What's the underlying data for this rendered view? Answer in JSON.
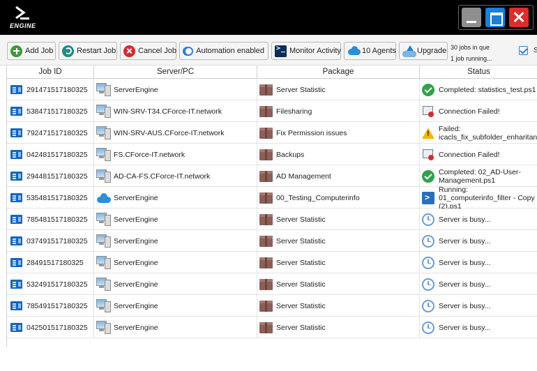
{
  "app": {
    "logo_text": "ENGINE"
  },
  "toolbar": {
    "add_job": "Add Job",
    "restart_job": "Restart Job",
    "cancel_job": "Cancel Job",
    "automation": "Automation enabled",
    "monitor_activity": "Monitor Activity",
    "agents": "10 Agents",
    "upgrade": "Upgrade",
    "queue_line1": "30 jobs in que",
    "queue_line2": "1 job running...",
    "checkbox_label": "S"
  },
  "colors": {
    "titlebar": "#000000",
    "accent": "#2f7dd6",
    "close": "#e02b2b",
    "maximize": "#1c7fd8",
    "minimize": "#8f8f8f"
  },
  "table": {
    "headers": {
      "job_id": "Job ID",
      "server": "Server/PC",
      "package": "Package",
      "status": "Status"
    },
    "rows": [
      {
        "id": "291471517180325",
        "server": "ServerEngine",
        "server_icon": "server-pc-icon",
        "package": "Server Statistic",
        "status": "Completed: statistics_test.ps1",
        "status_icon": "ok"
      },
      {
        "id": "538471517180325",
        "server": "WIN-SRV-T34.CForce-IT.network",
        "server_icon": "server-pc-icon",
        "package": "Filesharing",
        "status": "Connection Failed!",
        "status_icon": "fail"
      },
      {
        "id": "792471517180325",
        "server": "WIN-SRV-AUS.CForce-IT.network",
        "server_icon": "server-pc-icon",
        "package": "Fix Permission issues",
        "status": "Failed: icacls_fix_subfolder_enharitance",
        "status_icon": "warn"
      },
      {
        "id": "042481517180325",
        "server": "FS.CForce-IT.network",
        "server_icon": "server-pc-icon",
        "package": "Backups",
        "status": "Connection Failed!",
        "status_icon": "fail"
      },
      {
        "id": "294481517180325",
        "server": "AD-CA-FS.CForce-IT.network",
        "server_icon": "server-pc-icon",
        "package": "AD Management",
        "status": "Completed: 02_AD-User-Management.ps1",
        "status_icon": "ok"
      },
      {
        "id": "535481517180325",
        "server": "ServerEngine",
        "server_icon": "cloud-agent-icon",
        "package": "00_Testing_Computerinfo",
        "status": "Running: 01_computerinfo_filter - Copy (2).ps1",
        "status_icon": "run"
      },
      {
        "id": "785481517180325",
        "server": "ServerEngine",
        "server_icon": "server-pc-icon",
        "package": "Server Statistic",
        "status": "Server is busy...",
        "status_icon": "busy"
      },
      {
        "id": "037491517180325",
        "server": "ServerEngine",
        "server_icon": "server-pc-icon",
        "package": "Server Statistic",
        "status": "Server is busy...",
        "status_icon": "busy"
      },
      {
        "id": "28491517180325",
        "server": "ServerEngine",
        "server_icon": "server-pc-icon",
        "package": "Server Statistic",
        "status": "Server is busy...",
        "status_icon": "busy"
      },
      {
        "id": "532491517180325",
        "server": "ServerEngine",
        "server_icon": "server-pc-icon",
        "package": "Server Statistic",
        "status": "Server is busy...",
        "status_icon": "busy"
      },
      {
        "id": "785491517180325",
        "server": "ServerEngine",
        "server_icon": "server-pc-icon",
        "package": "Server Statistic",
        "status": "Server is busy...",
        "status_icon": "busy"
      },
      {
        "id": "042501517180325",
        "server": "ServerEngine",
        "server_icon": "server-pc-icon",
        "package": "Server Statistic",
        "status": "Server is busy...",
        "status_icon": "busy"
      }
    ]
  }
}
